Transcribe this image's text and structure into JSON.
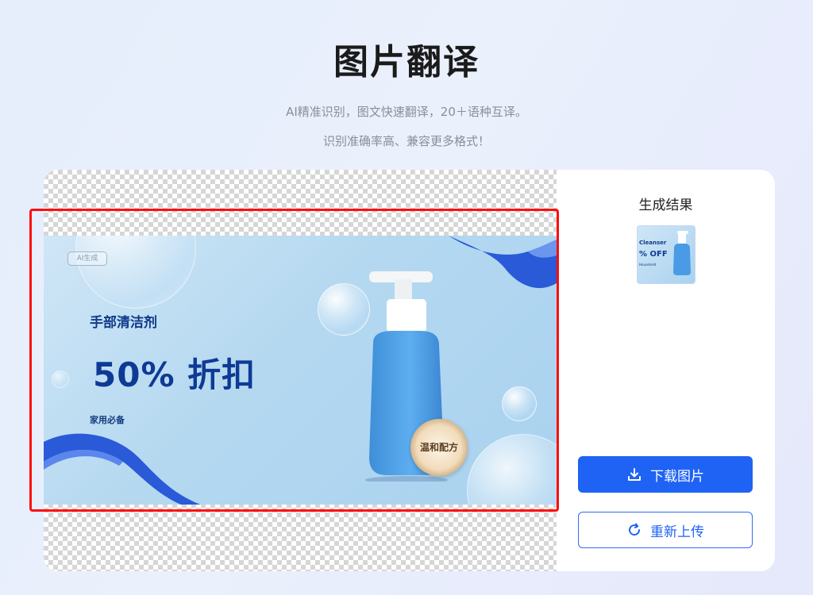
{
  "header": {
    "title": "图片翻译",
    "subtitle_line1": "AI精准识别，图文快速翻译，20＋语种互译。",
    "subtitle_line2": "识别准确率高、兼容更多格式！"
  },
  "product_image": {
    "ai_badge": "AI生成",
    "heading": "手部清洁剂",
    "discount": "50% 折扣",
    "tag": "家用必备",
    "seal": "温和配方"
  },
  "results": {
    "title": "生成结果",
    "thumbnail": {
      "line1": "Cleanser",
      "line2": "% OFF",
      "line3": "Household"
    }
  },
  "actions": {
    "download_label": "下载图片",
    "download_icon": "download-icon",
    "reupload_label": "重新上传",
    "reupload_icon": "refresh-icon"
  },
  "colors": {
    "primary": "#1f63f5",
    "selection": "#ff0d0d",
    "product_text": "#0e3a96"
  }
}
